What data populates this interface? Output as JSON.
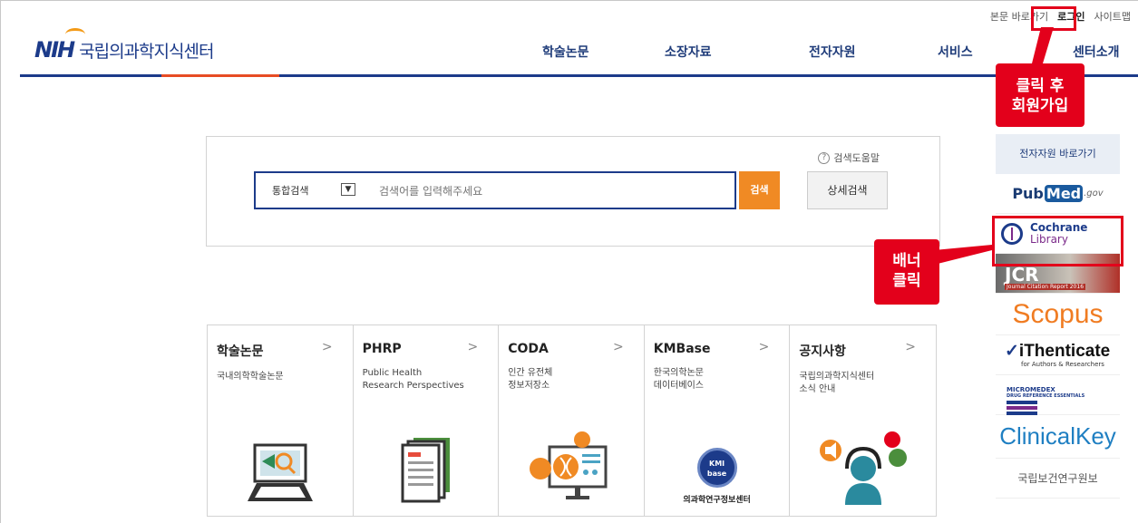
{
  "utility": {
    "skip": "본문 바로가기",
    "login": "로그인",
    "sitemap": "사이트맵"
  },
  "logo": {
    "mark": "NIH",
    "text": "국립의과학지식센터"
  },
  "nav": [
    "학술논문",
    "소장자료",
    "전자자원",
    "서비스",
    "센터소개"
  ],
  "annotations": {
    "login_note": "클릭 후\n회원가입",
    "banner_note": "배너\n클릭"
  },
  "search": {
    "help": "검색도움말",
    "category": "통합검색",
    "placeholder": "검색어를 입력해주세요",
    "button": "검색",
    "advanced": "상세검색"
  },
  "cards": [
    {
      "title": "학술논문",
      "desc": "국내의학학술논문"
    },
    {
      "title": "PHRP",
      "desc": "Public Health\nResearch Perspectives"
    },
    {
      "title": "CODA",
      "desc": "인간 유전체\n정보저장소"
    },
    {
      "title": "KMBase",
      "desc": "한국의학논문\n데이터베이스",
      "img_caption": "의과학연구정보센터",
      "seal": "KMI base"
    },
    {
      "title": "공지사항",
      "desc": "국립의과학지식센터\n소식 안내"
    }
  ],
  "sidebar": {
    "header": "전자자원 바로가기",
    "pubmed": {
      "pub": "Pub",
      "med": "Med",
      "gov": ".gov"
    },
    "cochrane": {
      "line1": "Cochrane",
      "line2": "Library"
    },
    "jcr": {
      "main": "JCR",
      "sub": "Journal Citation Report 2016"
    },
    "scopus": "Scopus",
    "ithenticate": {
      "main": "iThenticate",
      "sub": "for Authors & Researchers"
    },
    "micromedex": {
      "line1": "MICROMEDEX",
      "line2": "DRUG REFERENCE ESSENTIALS"
    },
    "clinicalkey": "ClinicalKey",
    "nih_report": "국립보건연구원보"
  },
  "colors": {
    "brand_blue": "#1c3b8a",
    "accent_orange": "#f08a24",
    "annotation_red": "#e3001b"
  }
}
